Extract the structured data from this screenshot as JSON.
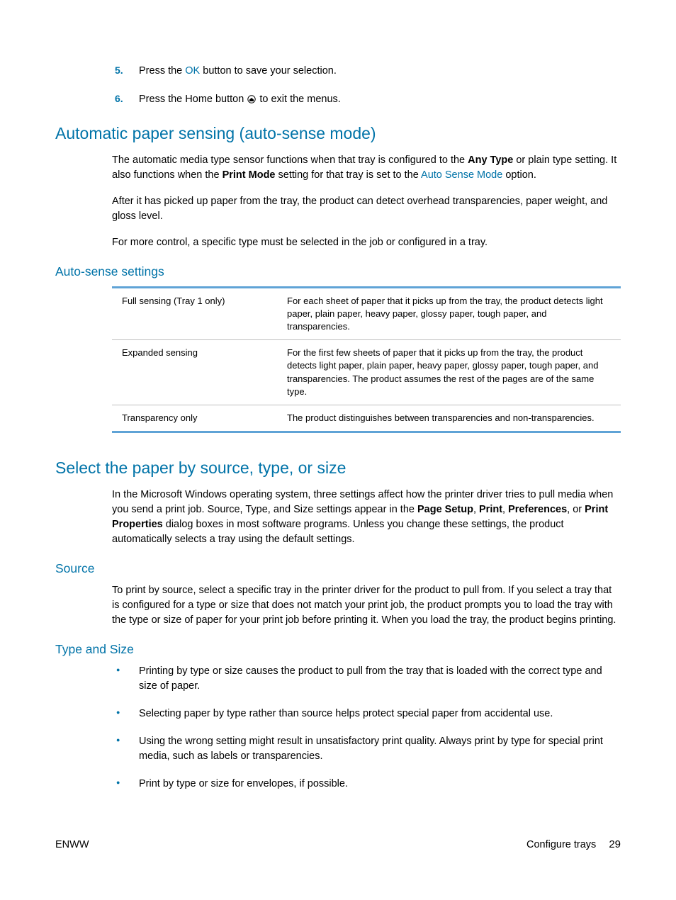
{
  "steps": [
    {
      "num": "5.",
      "pre": "Press the ",
      "link": "OK",
      "post": " button to save your selection."
    },
    {
      "num": "6.",
      "pre": "Press the Home button ",
      "icon": true,
      "post": " to exit the menus."
    }
  ],
  "section1": {
    "heading": "Automatic paper sensing (auto-sense mode)",
    "p1_a": "The automatic media type sensor functions when that tray is configured to the ",
    "p1_bold1": "Any Type",
    "p1_b": " or plain type setting. It also functions when the ",
    "p1_bold2": "Print Mode",
    "p1_c": " setting for that tray is set to the ",
    "p1_link": "Auto Sense Mode",
    "p1_d": " option.",
    "p2": "After it has picked up paper from the tray, the product can detect overhead transparencies, paper weight, and gloss level.",
    "p3": "For more control, a specific type must be selected in the job or configured in a tray."
  },
  "autosense": {
    "heading": "Auto-sense settings",
    "rows": [
      {
        "name": "Full sensing (Tray 1 only)",
        "desc": "For each sheet of paper that it picks up from the tray, the product detects light paper, plain paper, heavy paper, glossy paper, tough paper, and transparencies."
      },
      {
        "name": "Expanded sensing",
        "desc": "For the first few sheets of paper that it picks up from the tray, the product detects light paper, plain paper, heavy paper, glossy paper, tough paper, and transparencies. The product assumes the rest of the pages are of the same type."
      },
      {
        "name": "Transparency only",
        "desc": "The product distinguishes between transparencies and non-transparencies."
      }
    ]
  },
  "section2": {
    "heading": "Select the paper by source, type, or size",
    "p_a": "In the Microsoft Windows operating system, three settings affect how the printer driver tries to pull media when you send a print job. Source, Type, and Size settings appear in the ",
    "p_b1": "Page Setup",
    "p_c": ", ",
    "p_b2": "Print",
    "p_d": ", ",
    "p_b3": "Preferences",
    "p_e": ", or ",
    "p_b4": "Print Properties",
    "p_f": " dialog boxes in most software programs. Unless you change these settings, the product automatically selects a tray using the default settings."
  },
  "source": {
    "heading": "Source",
    "p": "To print by source, select a specific tray in the printer driver for the product to pull from. If you select a tray that is configured for a type or size that does not match your print job, the product prompts you to load the tray with the type or size of paper for your print job before printing it. When you load the tray, the product begins printing."
  },
  "typesize": {
    "heading": "Type and Size",
    "bullets": [
      "Printing by type or size causes the product to pull from the tray that is loaded with the correct type and size of paper.",
      "Selecting paper by type rather than source helps protect special paper from accidental use.",
      "Using the wrong setting might result in unsatisfactory print quality. Always print by type for special print media, such as labels or transparencies.",
      "Print by type or size for envelopes, if possible."
    ]
  },
  "footer": {
    "left": "ENWW",
    "right_label": "Configure trays",
    "page": "29"
  }
}
